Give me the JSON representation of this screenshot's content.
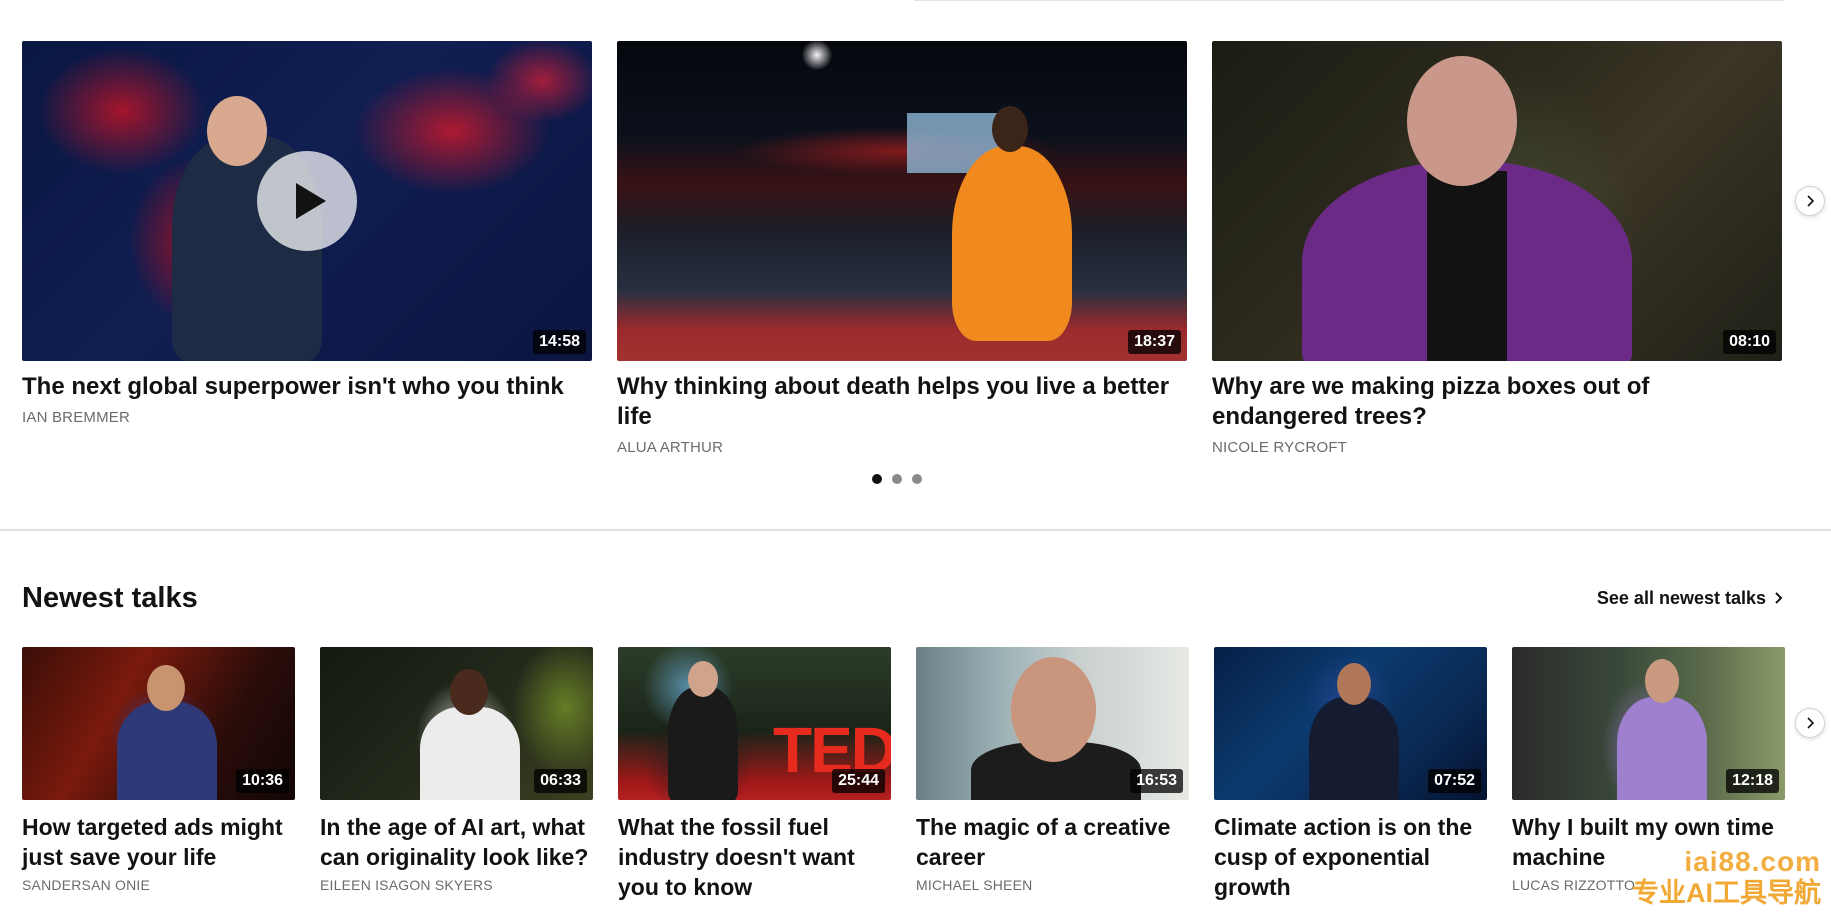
{
  "featured": {
    "talks": [
      {
        "title": "The next global superpower isn't who you think",
        "speaker": "IAN BREMMER",
        "duration": "14:58"
      },
      {
        "title": "Why thinking about death helps you live a better life",
        "speaker": "ALUA ARTHUR",
        "duration": "18:37"
      },
      {
        "title": "Why are we making pizza boxes out of endangered trees?",
        "speaker": "NICOLE RYCROFT",
        "duration": "08:10"
      }
    ],
    "pagination": {
      "total": 3,
      "active": 1
    },
    "icons": {
      "play": "play-icon",
      "next": "chevron-right-icon"
    }
  },
  "newest": {
    "title": "Newest talks",
    "see_all_label": "See all newest talks",
    "talks": [
      {
        "title": "How targeted ads might just save your life",
        "speaker": "SANDERSAN ONIE",
        "duration": "10:36"
      },
      {
        "title": "In the age of AI art, what can originality look like?",
        "speaker": "EILEEN ISAGON SKYERS",
        "duration": "06:33"
      },
      {
        "title": "What the fossil fuel industry doesn't want you to know",
        "speaker": "",
        "duration": "25:44"
      },
      {
        "title": "The magic of a creative career",
        "speaker": "MICHAEL SHEEN",
        "duration": "16:53"
      },
      {
        "title": "Climate action is on the cusp of exponential growth",
        "speaker": "",
        "duration": "07:52"
      },
      {
        "title": "Why I built my own time machine",
        "speaker": "LUCAS RIZZOTTO",
        "duration": "12:18"
      }
    ]
  },
  "stage_text": "TED",
  "watermark": {
    "url": "iai88.com",
    "text": "专业AI工具导航"
  },
  "colors": {
    "accent": "#e62b1e",
    "text": "#121212",
    "muted": "#6b6b6b",
    "watermark": "#f0a020"
  }
}
